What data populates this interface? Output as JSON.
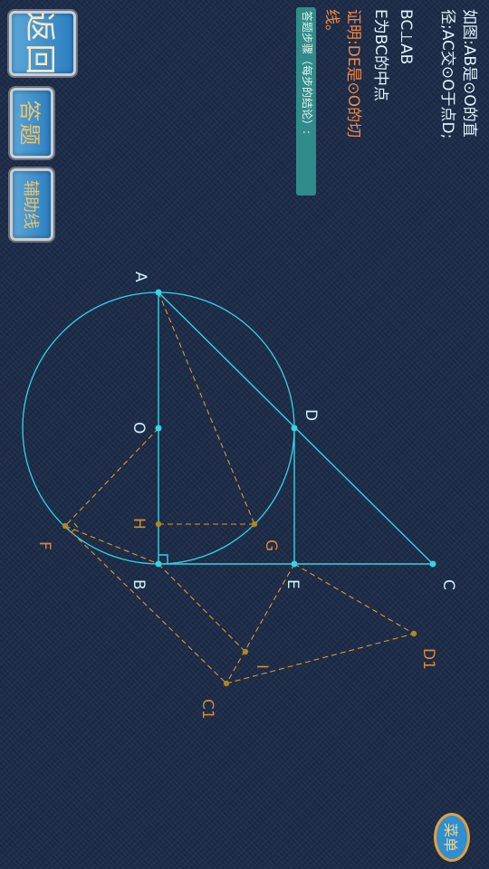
{
  "buttons": {
    "back_label": "返回",
    "answer_label": "答题",
    "aux_line_label": "辅助线",
    "menu_label": "菜单"
  },
  "problem": {
    "line1": "如图:AB是⊙O的直",
    "line2": "径;AC交⊙O于点D;",
    "line3": "BC⊥AB",
    "line4": "E为BC的中点",
    "goal_line1": "证明:DE是⊙O的切",
    "goal_line2": "线。"
  },
  "steps_label": "答题步骤（每步的结论）:",
  "figure": {
    "points": {
      "A": "A",
      "B": "B",
      "C": "C",
      "D": "D",
      "E": "E",
      "O": "O",
      "H": "H",
      "G": "G",
      "F": "F",
      "I": "I",
      "C1": "C1",
      "D1": "D1"
    },
    "colors": {
      "main_lines": "#35d3e3",
      "aux_lines": "#d89a2a",
      "main_points": "#35d3e3",
      "aux_points": "#b4841f",
      "main_labels": "#cfeef8",
      "aux_labels": "#d68a33"
    }
  },
  "colors": {
    "background": "#1b2a47",
    "problem_text": "#dff3fb",
    "goal_text": "#f08a4c",
    "button_fill": "#3c93cf",
    "steps_label_bg": "#2f8c8a"
  }
}
